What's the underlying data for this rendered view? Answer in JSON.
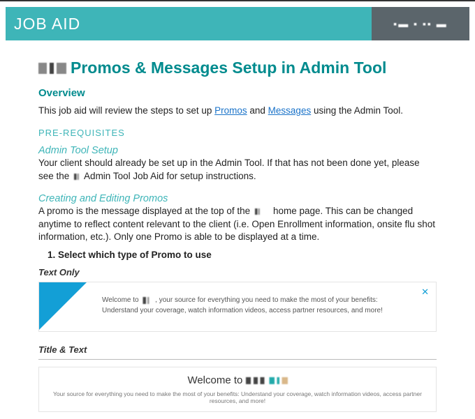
{
  "header": {
    "title": "JOB AID"
  },
  "doc": {
    "title_suffix": "Promos & Messages Setup in Admin Tool",
    "overview_heading": "Overview",
    "overview_text_pre": "This job aid will review the steps to set up ",
    "overview_link1": "Promos",
    "overview_text_mid": " and ",
    "overview_link2": "Messages",
    "overview_text_post": " using the Admin Tool.",
    "prereq_heading": "PRE-REQUISITES",
    "admin_setup_heading": "Admin Tool Setup",
    "admin_setup_text_pre": "Your client should already be set up in the Admin Tool.  If that has not been done yet, please see the ",
    "admin_setup_text_post": " Admin Tool Job Aid for setup instructions.",
    "promos_heading": "Creating and Editing Promos",
    "promos_text_pre": "A promo is the message displayed at the top of the ",
    "promos_text_post": " home page.  This can be changed anytime to reflect content relevant to the client (i.e. Open Enrollment information, onsite flu shot information, etc.).  Only one Promo is able to be displayed at a time.",
    "step1": "Select which type of Promo to use",
    "style_text_only": "Text Only",
    "style_title_text": "Title & Text"
  },
  "promo1": {
    "text_pre": "Welcome to ",
    "text_post": ", your source for everything you need to make the most of your benefits: Understand your coverage, watch information videos, access partner resources, and more!"
  },
  "promo2": {
    "title_pre": "Welcome to ",
    "subtext": "Your source for everything you need to make the most of your benefits: Understand your coverage, watch information videos, access partner resources, and more!"
  }
}
